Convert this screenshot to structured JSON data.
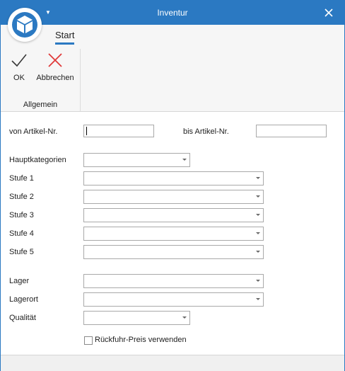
{
  "window": {
    "title": "Inventur",
    "accent": "#2b79c2"
  },
  "icons": {
    "app": "cube-icon",
    "quick_access": "chevron-down-icon",
    "close": "close-icon",
    "ok": "checkmark-icon",
    "cancel": "x-icon"
  },
  "ribbon": {
    "tab_label": "Start",
    "group_label": "Allgemein",
    "ok_label": "OK",
    "cancel_label": "Abbrechen"
  },
  "form": {
    "von_artikel_label": "von Artikel-Nr.",
    "von_artikel_value": "",
    "bis_artikel_label": "bis Artikel-Nr.",
    "bis_artikel_value": "",
    "hauptkategorien_label": "Hauptkategorien",
    "hauptkategorien_value": "",
    "stufe1_label": "Stufe 1",
    "stufe2_label": "Stufe 2",
    "stufe3_label": "Stufe 3",
    "stufe4_label": "Stufe 4",
    "stufe5_label": "Stufe 5",
    "lager_label": "Lager",
    "lagerort_label": "Lagerort",
    "qualitaet_label": "Qualität",
    "rueckfuhr_label": "Rückfuhr-Preis verwenden",
    "rueckfuhr_checked": false
  }
}
